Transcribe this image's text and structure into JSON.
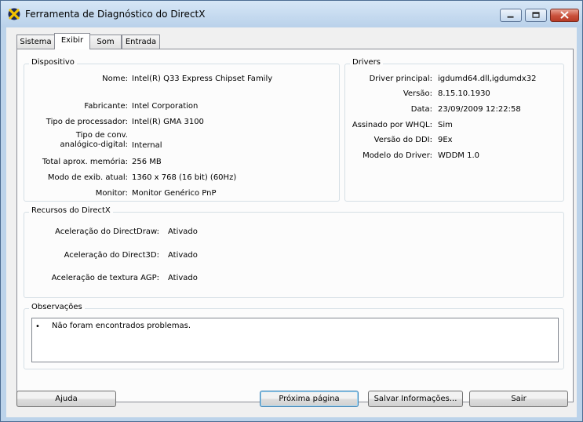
{
  "window": {
    "title": "Ferramenta de Diagnóstico do DirectX"
  },
  "tabs": [
    {
      "label": "Sistema"
    },
    {
      "label": "Exibir"
    },
    {
      "label": "Som"
    },
    {
      "label": "Entrada"
    }
  ],
  "device": {
    "title": "Dispositivo",
    "rows": [
      {
        "label": "Nome:",
        "value": "Intel(R) Q33 Express Chipset Family"
      },
      {
        "label": "Fabricante:",
        "value": "Intel Corporation"
      },
      {
        "label": "Tipo de processador:",
        "value": "Intel(R) GMA 3100"
      },
      {
        "label": "Tipo de conv. analógico-digital:",
        "value": "Internal"
      },
      {
        "label": "Total aprox. memória:",
        "value": "256 MB"
      },
      {
        "label": "Modo de exib. atual:",
        "value": "1360 x 768 (16 bit) (60Hz)"
      },
      {
        "label": "Monitor:",
        "value": "Monitor Genérico PnP"
      }
    ]
  },
  "drivers": {
    "title": "Drivers",
    "rows": [
      {
        "label": "Driver principal:",
        "value": "igdumd64.dll,igdumdx32"
      },
      {
        "label": "Versão:",
        "value": "8.15.10.1930"
      },
      {
        "label": "Data:",
        "value": "23/09/2009 12:22:58"
      },
      {
        "label": "Assinado por WHQL:",
        "value": "Sim"
      },
      {
        "label": "Versão do DDI:",
        "value": "9Ex"
      },
      {
        "label": "Modelo do Driver:",
        "value": "WDDM 1.0"
      }
    ]
  },
  "directx": {
    "title": "Recursos do DirectX",
    "rows": [
      {
        "label": "Aceleração do DirectDraw:",
        "value": "Ativado"
      },
      {
        "label": "Aceleração do Direct3D:",
        "value": "Ativado"
      },
      {
        "label": "Aceleração de textura AGP:",
        "value": "Ativado"
      }
    ]
  },
  "notes": {
    "title": "Observações",
    "bullet": "•",
    "items": [
      "Não foram encontrados problemas."
    ]
  },
  "buttons": {
    "help": "Ajuda",
    "next": "Próxima página",
    "save": "Salvar Informações...",
    "exit": "Sair"
  },
  "colors": {
    "titlebar": "#c9dcf0",
    "panel": "#fcfcfc",
    "icon_yellow": "#f2c200",
    "icon_dark": "#1d2a57",
    "close": "#c94f3a"
  }
}
